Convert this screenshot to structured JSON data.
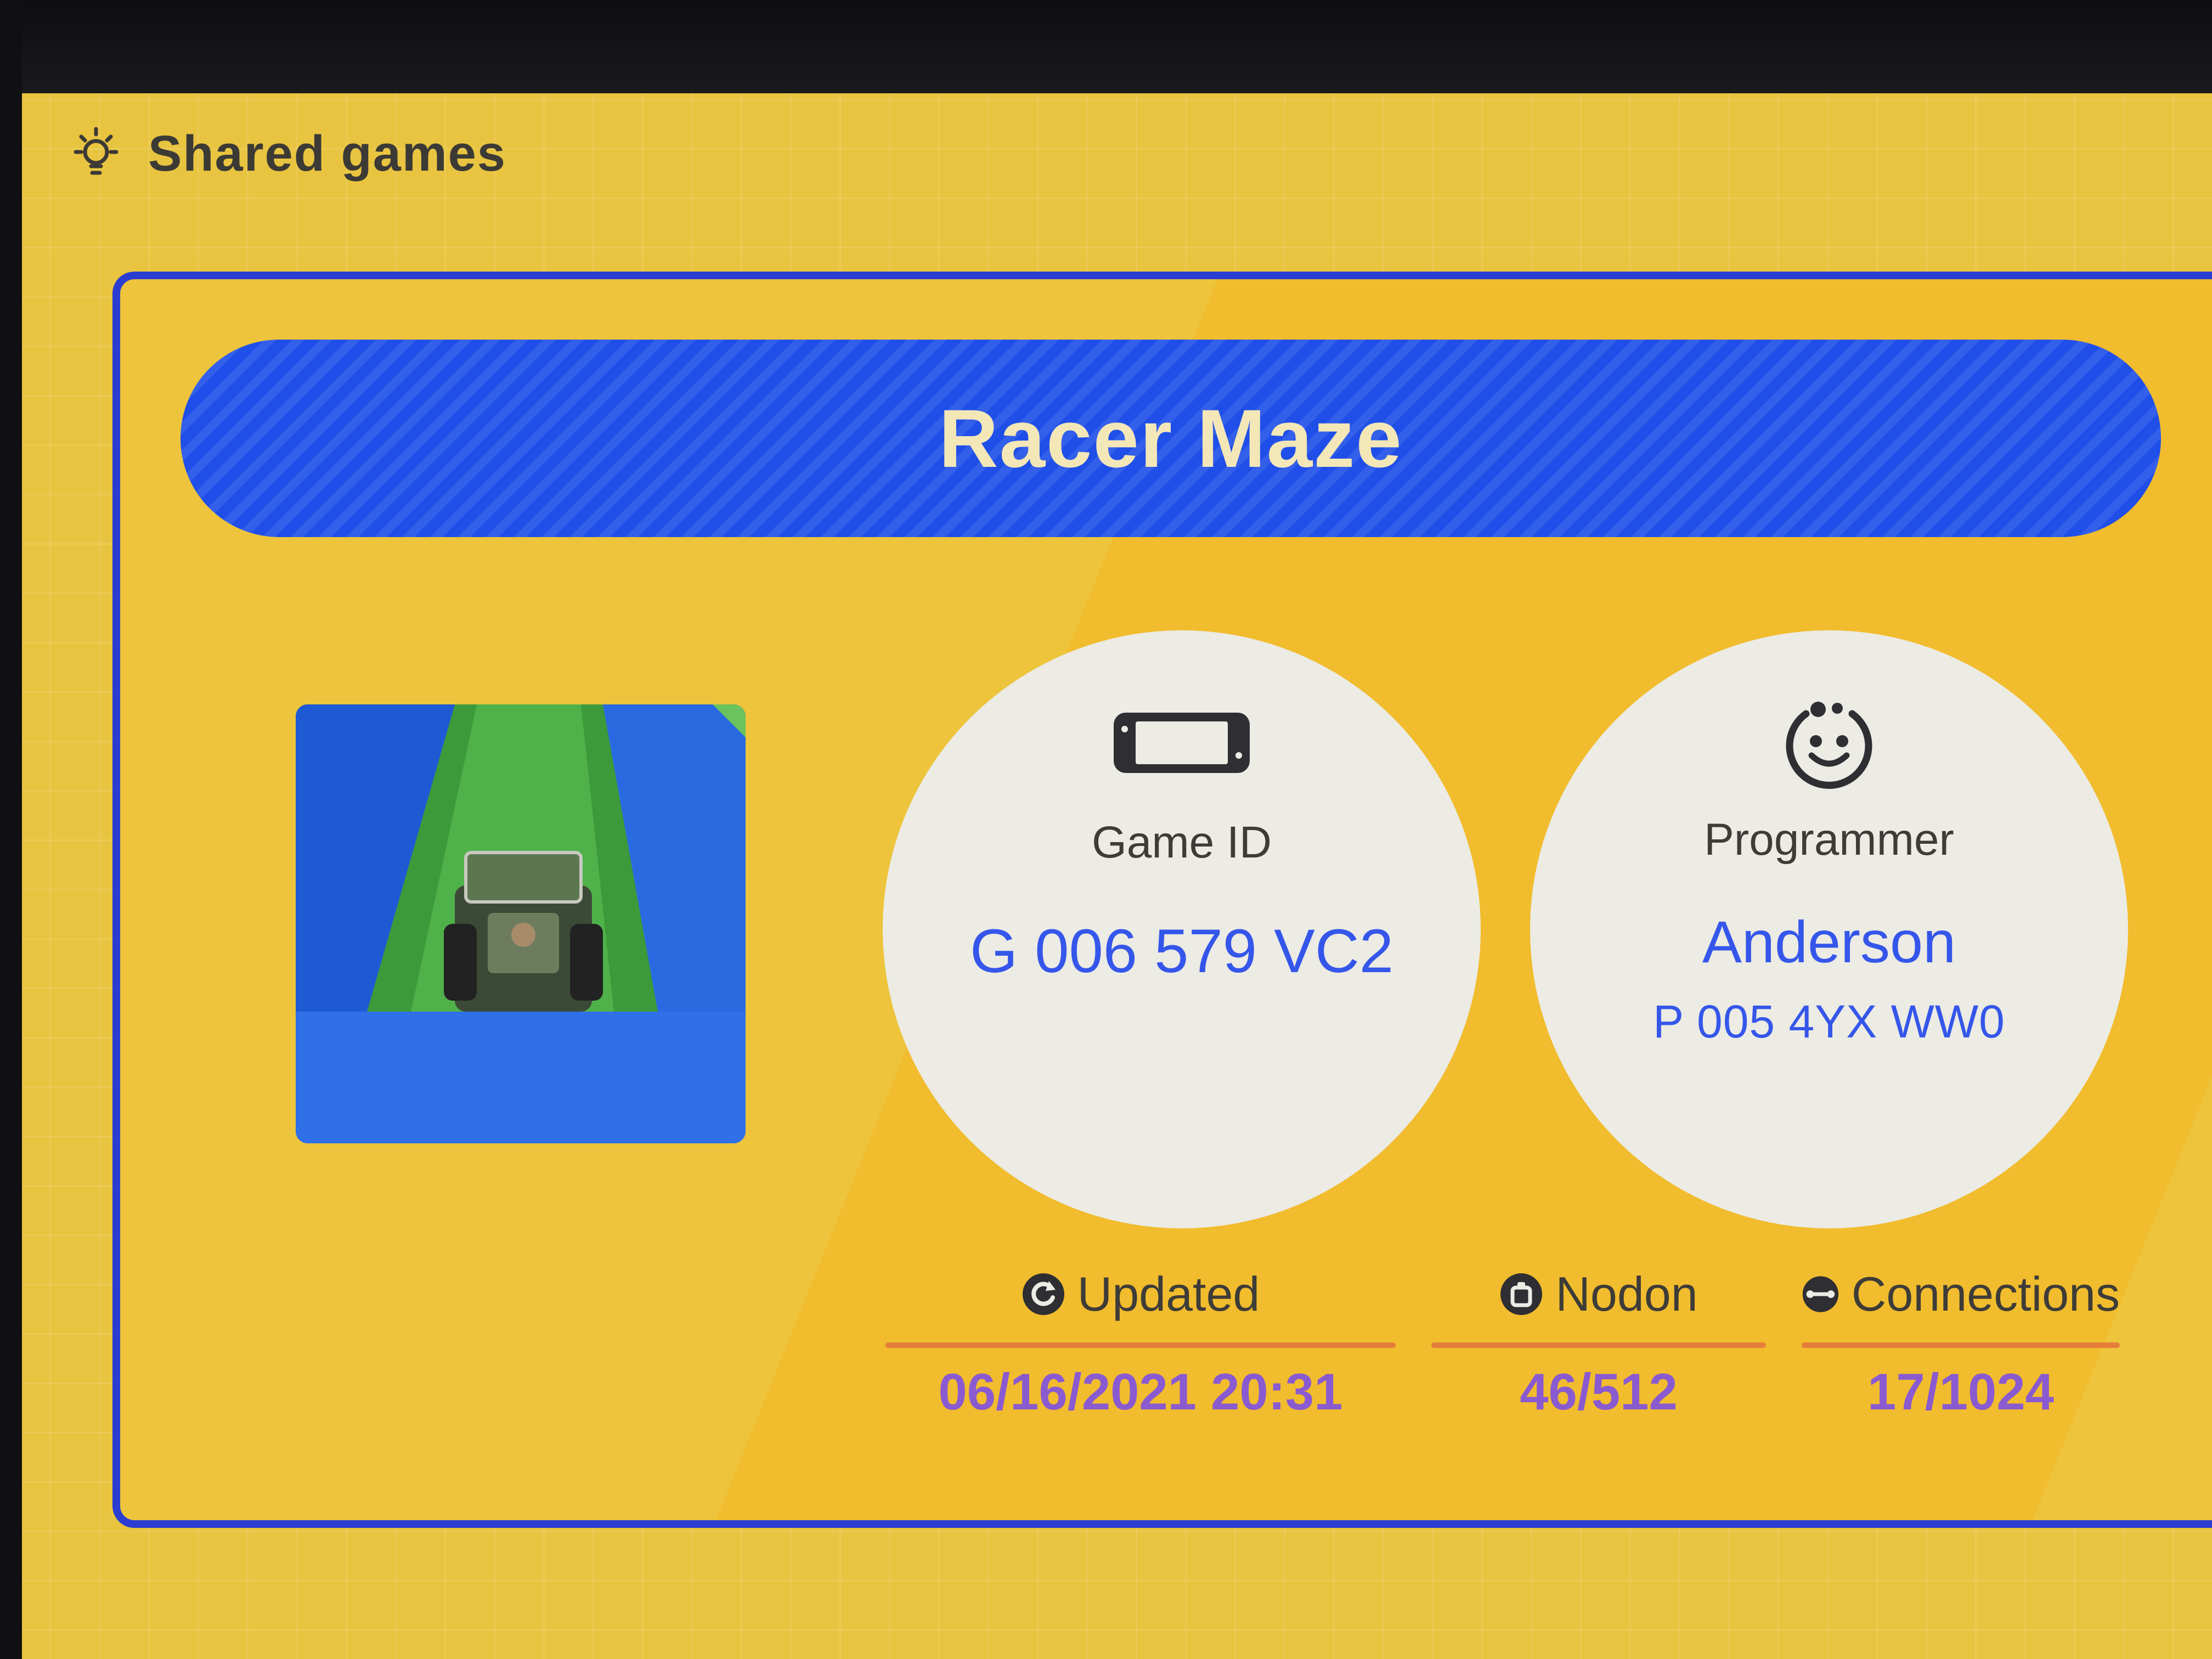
{
  "header": {
    "title": "Shared games",
    "icon": "lightbulb-icon"
  },
  "game": {
    "title": "Racer Maze",
    "thumbnail": "racer-maze-thumbnail"
  },
  "game_id": {
    "label": "Game ID",
    "value": "G 006 579 VC2",
    "icon": "console-icon"
  },
  "programmer": {
    "label": "Programmer",
    "name": "Anderson",
    "id": "P 005 4YX WW0",
    "icon": "programmer-face-icon"
  },
  "stats": {
    "updated": {
      "label": "Updated",
      "value": "06/16/2021 20:31",
      "icon": "refresh-icon"
    },
    "nodon": {
      "label": "Nodon",
      "value": "46/512",
      "icon": "nodon-icon"
    },
    "connections": {
      "label": "Connections",
      "value": "17/1024",
      "icon": "connection-icon"
    }
  },
  "colors": {
    "background": "#e8c440",
    "accent_blue": "#1f4fe8",
    "value_blue": "#3556ea",
    "stat_value": "#8a5ad0",
    "rule_orange": "#e57d3a"
  }
}
